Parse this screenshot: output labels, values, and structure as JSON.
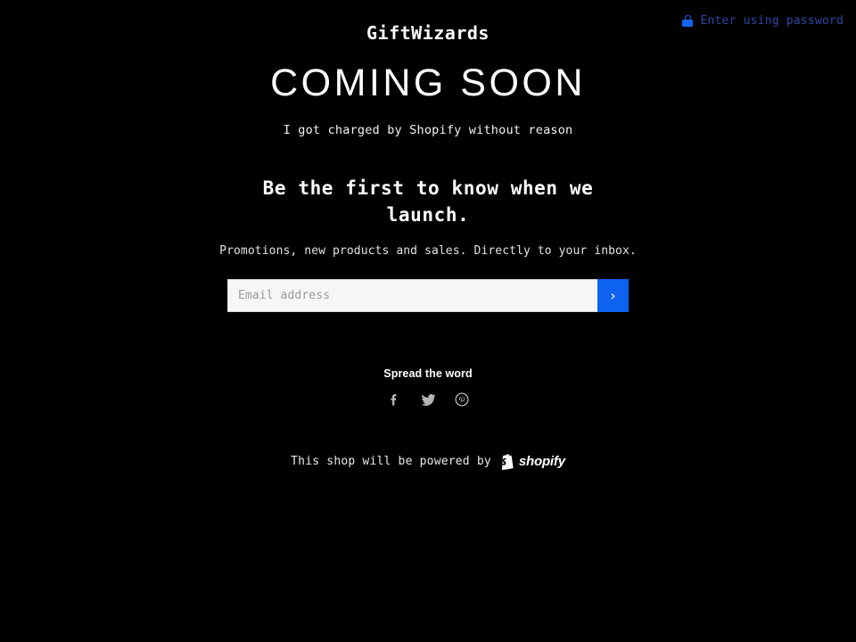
{
  "page": {
    "background_color": "#000000",
    "text_color": "#ffffff"
  },
  "password_bar": {
    "lock_icon": "lock-icon",
    "link_label": "Enter using password",
    "link_color": "#2b48a6",
    "lock_color": "#1463f3"
  },
  "hero": {
    "shop_title": "GiftWizards",
    "coming_soon": "COMING SOON",
    "tagline": "I got charged by Shopify without reason"
  },
  "signup": {
    "heading": "Be the first to know when we launch.",
    "subtext": "Promotions, new products and sales. Directly to your inbox.",
    "email_placeholder": "Email address",
    "email_value": "",
    "submit_glyph": "›",
    "submit_color": "#0d63f0",
    "input_background": "#f6f6f6"
  },
  "social": {
    "label": "Spread the word",
    "icon_color": "#b5b5b5",
    "items": [
      {
        "name": "facebook-icon",
        "label": "Facebook"
      },
      {
        "name": "twitter-icon",
        "label": "Twitter"
      },
      {
        "name": "pinterest-icon",
        "label": "Pinterest"
      }
    ]
  },
  "footer": {
    "text": "This shop will be powered by",
    "brand": "shopify",
    "brand_mark": "shopify-bag-icon"
  }
}
